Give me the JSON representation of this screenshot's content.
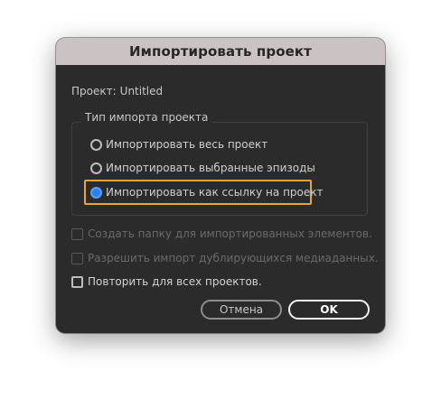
{
  "dialog": {
    "title": "Импортировать проект"
  },
  "project": {
    "label": "Проект:",
    "value": "Untitled"
  },
  "import_type": {
    "legend": "Тип импорта проекта",
    "options": [
      {
        "label": "Импортировать весь проект",
        "selected": false
      },
      {
        "label": "Импортировать выбранные эпизоды",
        "selected": false
      },
      {
        "label": "Импортировать как ссылку на проект",
        "selected": true
      }
    ]
  },
  "options": {
    "create_folder": {
      "label": "Создать папку для импортированных элементов.",
      "checked": false,
      "enabled": false
    },
    "allow_duplicates": {
      "label": "Разрешить импорт дублирующихся медиаданных.",
      "checked": false,
      "enabled": false
    },
    "repeat_all": {
      "label": "Повторить для всех проектов.",
      "checked": false,
      "enabled": true
    }
  },
  "buttons": {
    "cancel_label": "Отмена",
    "ok_label": "OK"
  },
  "colors": {
    "accent": "#2d7ff0",
    "focus": "#e8a33a",
    "titlebar": "#cbc3c3",
    "background": "#2b2b2b"
  }
}
